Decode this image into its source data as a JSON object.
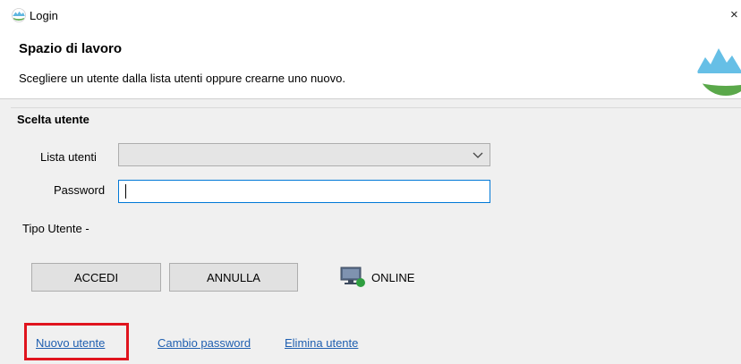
{
  "window": {
    "title": "Login",
    "close_glyph": "×",
    "icon": "mountain-logo-icon"
  },
  "header": {
    "title": "Spazio di lavoro",
    "description": "Scegliere un utente dalla lista utenti oppure crearne uno nuovo."
  },
  "section": {
    "title": "Scelta utente"
  },
  "form": {
    "users_label": "Lista utenti",
    "users_value": "",
    "password_label": "Password",
    "password_value": "",
    "user_type_label": "Tipo Utente  -"
  },
  "buttons": {
    "accedi": "ACCEDI",
    "annulla": "ANNULLA"
  },
  "status": {
    "text": "ONLINE",
    "icon": "monitor-online-icon",
    "color": "#2e9e3f"
  },
  "links": {
    "new_user": "Nuovo utente",
    "change_password": "Cambio password",
    "delete_user": "Elimina utente"
  },
  "colors": {
    "link": "#1f5fb0",
    "highlight": "#e0141e",
    "focus": "#0078d7"
  }
}
